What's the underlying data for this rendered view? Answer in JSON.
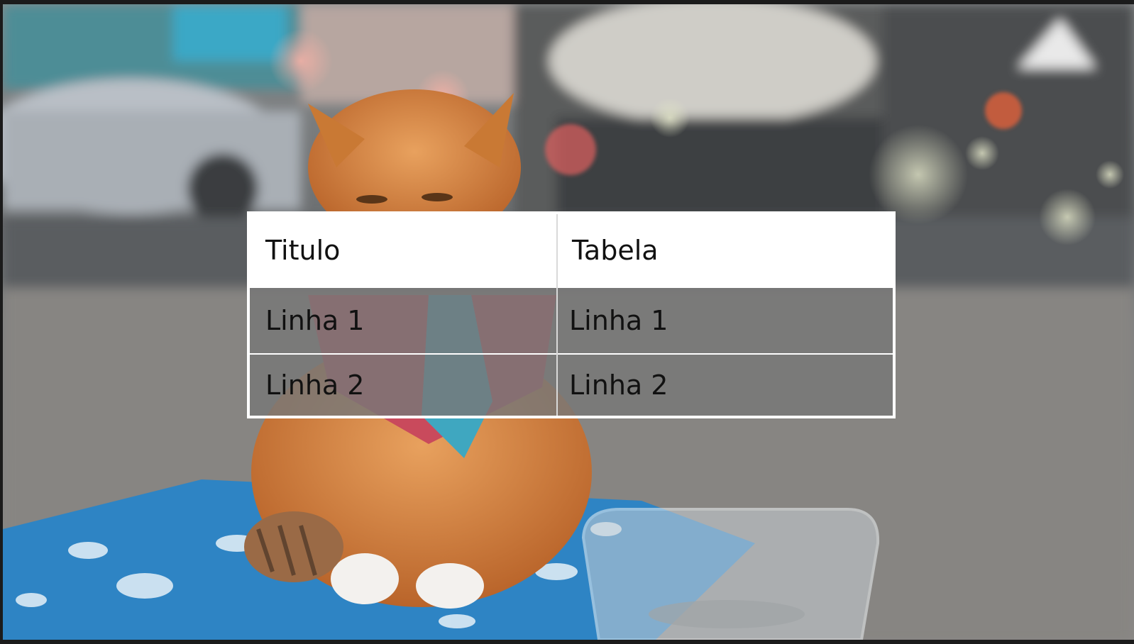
{
  "table": {
    "headers": [
      "Titulo",
      "Tabela"
    ],
    "rows": [
      [
        "Linha 1",
        "Linha 1"
      ],
      [
        "Linha 2",
        "Linha 2"
      ]
    ]
  },
  "background": {
    "subject": "photo-cat-on-blanket"
  }
}
